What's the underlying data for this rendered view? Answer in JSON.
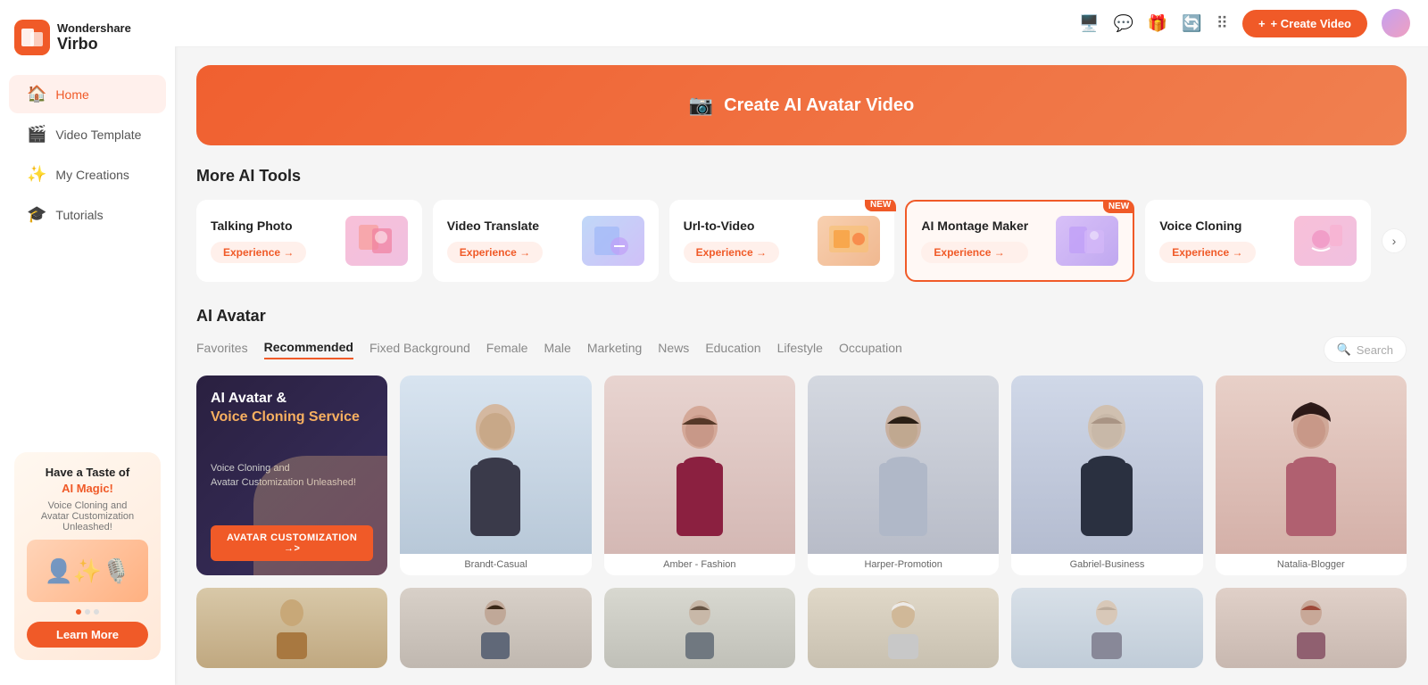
{
  "app": {
    "name": "Wondershare",
    "product": "Virbo"
  },
  "sidebar": {
    "nav_items": [
      {
        "id": "home",
        "label": "Home",
        "icon": "🏠",
        "active": true
      },
      {
        "id": "video-template",
        "label": "Video Template",
        "icon": "🎬",
        "active": false
      },
      {
        "id": "my-creations",
        "label": "My Creations",
        "icon": "🎓",
        "active": false
      },
      {
        "id": "tutorials",
        "label": "Tutorials",
        "icon": "🎓",
        "active": false
      }
    ],
    "promo": {
      "title": "Have a Taste of",
      "highlight": "AI Magic!",
      "sub": "Voice Cloning and\nAvatar Customization Unleashed!",
      "learn_more": "Learn More"
    }
  },
  "topbar": {
    "create_video": "+ Create Video",
    "icons": [
      "monitor",
      "chat",
      "gift",
      "refresh",
      "grid"
    ]
  },
  "hero": {
    "text": "Create AI Avatar Video"
  },
  "more_ai_tools": {
    "section_title": "More AI Tools",
    "tools": [
      {
        "id": "talking-photo",
        "name": "Talking Photo",
        "experience": "Experience →",
        "badge": "",
        "image_type": "pink"
      },
      {
        "id": "video-translate",
        "name": "Video Translate",
        "experience": "Experience →",
        "badge": "",
        "image_type": "blue"
      },
      {
        "id": "url-to-video",
        "name": "Url-to-Video",
        "experience": "Experience →",
        "badge": "NEW",
        "image_type": "orange"
      },
      {
        "id": "ai-montage",
        "name": "AI Montage Maker",
        "experience": "Experience →",
        "badge": "NEW",
        "image_type": "purple",
        "highlighted": true
      },
      {
        "id": "voice-cloning",
        "name": "Voice Cloning",
        "experience": "Experience →",
        "badge": "",
        "image_type": "pink"
      }
    ]
  },
  "ai_avatar": {
    "section_title": "AI Avatar",
    "tabs": [
      {
        "id": "favorites",
        "label": "Favorites",
        "active": false
      },
      {
        "id": "recommended",
        "label": "Recommended",
        "active": true
      },
      {
        "id": "fixed-background",
        "label": "Fixed Background",
        "active": false
      },
      {
        "id": "female",
        "label": "Female",
        "active": false
      },
      {
        "id": "male",
        "label": "Male",
        "active": false
      },
      {
        "id": "marketing",
        "label": "Marketing",
        "active": false
      },
      {
        "id": "news",
        "label": "News",
        "active": false
      },
      {
        "id": "education",
        "label": "Education",
        "active": false
      },
      {
        "id": "lifestyle",
        "label": "Lifestyle",
        "active": false
      },
      {
        "id": "occupation",
        "label": "Occupation",
        "active": false
      }
    ],
    "search_placeholder": "Search",
    "avatars": [
      {
        "id": "promo",
        "type": "promo",
        "title": "AI Avatar &\nVoice Cloning Service",
        "sub": "Voice Cloning and\nAvatar Customization Unleashed!",
        "btn": "AVATAR CUSTOMIZATION →>"
      },
      {
        "id": "brandt",
        "label": "Brandt-Casual",
        "type": "male1"
      },
      {
        "id": "amber",
        "label": "Amber - Fashion",
        "type": "female1"
      },
      {
        "id": "harper",
        "label": "Harper-Promotion",
        "type": "female2"
      },
      {
        "id": "gabriel",
        "label": "Gabriel-Business",
        "type": "male2"
      },
      {
        "id": "natalia",
        "label": "Natalia-Blogger",
        "type": "female3"
      }
    ],
    "avatars_row2": [
      {
        "id": "r2-1",
        "label": "",
        "type": "male-casual"
      },
      {
        "id": "r2-2",
        "label": "",
        "type": "female-dark"
      },
      {
        "id": "r2-3",
        "label": "",
        "type": "female-mid"
      },
      {
        "id": "r2-4",
        "label": "",
        "type": "male-arab"
      },
      {
        "id": "r2-5",
        "label": "",
        "type": "male-light"
      },
      {
        "id": "r2-6",
        "label": "",
        "type": "female-red"
      }
    ]
  }
}
